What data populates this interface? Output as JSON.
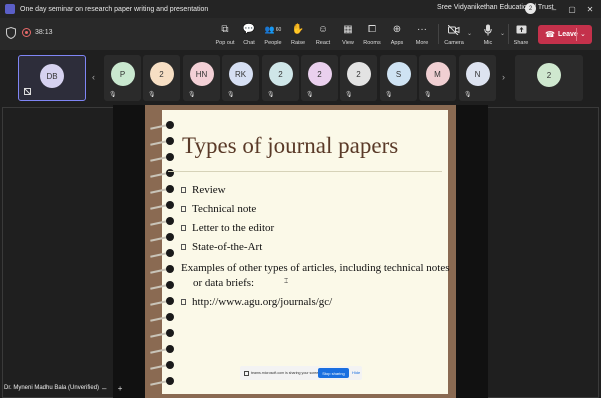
{
  "window": {
    "title": "One day seminar on research paper writing and presentation",
    "org": "Sree Vidyanikethan Educational Trust",
    "org_avatar": "2",
    "minimize": "–",
    "maximize": "▢",
    "close": "✕"
  },
  "meeting": {
    "timer": "38:13",
    "actions": [
      {
        "icon": "pop-out-icon",
        "glyph": "⧉",
        "label": "Pop out"
      },
      {
        "icon": "chat-icon",
        "glyph": "💬",
        "label": "Chat"
      },
      {
        "icon": "people-icon",
        "glyph": "👥",
        "label": "People",
        "badge": "60"
      },
      {
        "icon": "raise-hand-icon",
        "glyph": "✋",
        "label": "Raise"
      },
      {
        "icon": "react-icon",
        "glyph": "☺",
        "label": "React"
      },
      {
        "icon": "view-icon",
        "glyph": "▦",
        "label": "View"
      },
      {
        "icon": "rooms-icon",
        "glyph": "⧠",
        "label": "Rooms"
      },
      {
        "icon": "apps-icon",
        "glyph": "⊕",
        "label": "Apps"
      },
      {
        "icon": "more-icon",
        "glyph": "···",
        "label": "More"
      }
    ],
    "camera_label": "Camera",
    "mic_label": "Mic",
    "share_label": "Share",
    "leave_label": "Leave",
    "leave_glyph": "☎",
    "caret": "⌄"
  },
  "participants": {
    "self": {
      "initials": "DB",
      "color": "#d6d2f0"
    },
    "list": [
      {
        "initials": "P",
        "color": "#c9e8cf"
      },
      {
        "initials": "2",
        "color": "#f7dfc4"
      },
      {
        "initials": "HN",
        "color": "#f3d0d6"
      },
      {
        "initials": "RK",
        "color": "#d6dff3"
      },
      {
        "initials": "2",
        "color": "#cfe6e8"
      },
      {
        "initials": "2",
        "color": "#ead0ee"
      },
      {
        "initials": "2",
        "color": "#e3e3e3"
      },
      {
        "initials": "S",
        "color": "#cfe3f3"
      },
      {
        "initials": "M",
        "color": "#f0cfd2"
      },
      {
        "initials": "N",
        "color": "#dde3f0"
      }
    ],
    "overflow": {
      "initials": "2",
      "color": "#cfe8cf"
    },
    "prev": "‹",
    "next": "›",
    "mic_off_glyph": "🎙"
  },
  "slide": {
    "title": "Types of journal papers",
    "bullets": [
      "Review",
      "Technical note",
      "Letter to the editor",
      "State-of-the-Art"
    ],
    "paragraph_line1": "Examples of other types of articles, including technical notes",
    "paragraph_line2": "or data briefs:",
    "link": "http://www.agu.org/journals/gc/"
  },
  "share_bar": {
    "text": "teams.microsoft.com is sharing your screen.",
    "stop_label": "Stop sharing",
    "hide_label": "Hide"
  },
  "presenter": {
    "name": "Dr. Myneni Madhu Bala (Unverified)",
    "zoom_out": "–",
    "zoom_in": "+"
  }
}
